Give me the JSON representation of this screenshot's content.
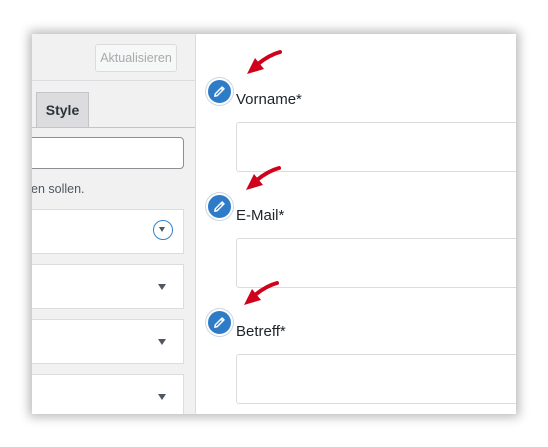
{
  "toolbar": {
    "update_label": "Aktualisieren"
  },
  "panel": {
    "tabs": [
      {
        "label": "Style"
      }
    ],
    "hint_text": "en sollen."
  },
  "form": {
    "fields": [
      {
        "label": "Vorname*",
        "value": ""
      },
      {
        "label": "E-Mail*",
        "value": ""
      },
      {
        "label": "Betreff*",
        "value": ""
      }
    ]
  },
  "icons": {
    "edit": "pencil-icon",
    "annotation": "red-arrow-icon",
    "dropdown": "chevron-down-icon"
  },
  "colors": {
    "accent": "#2e7cc8",
    "annotation_red": "#d0021b"
  }
}
